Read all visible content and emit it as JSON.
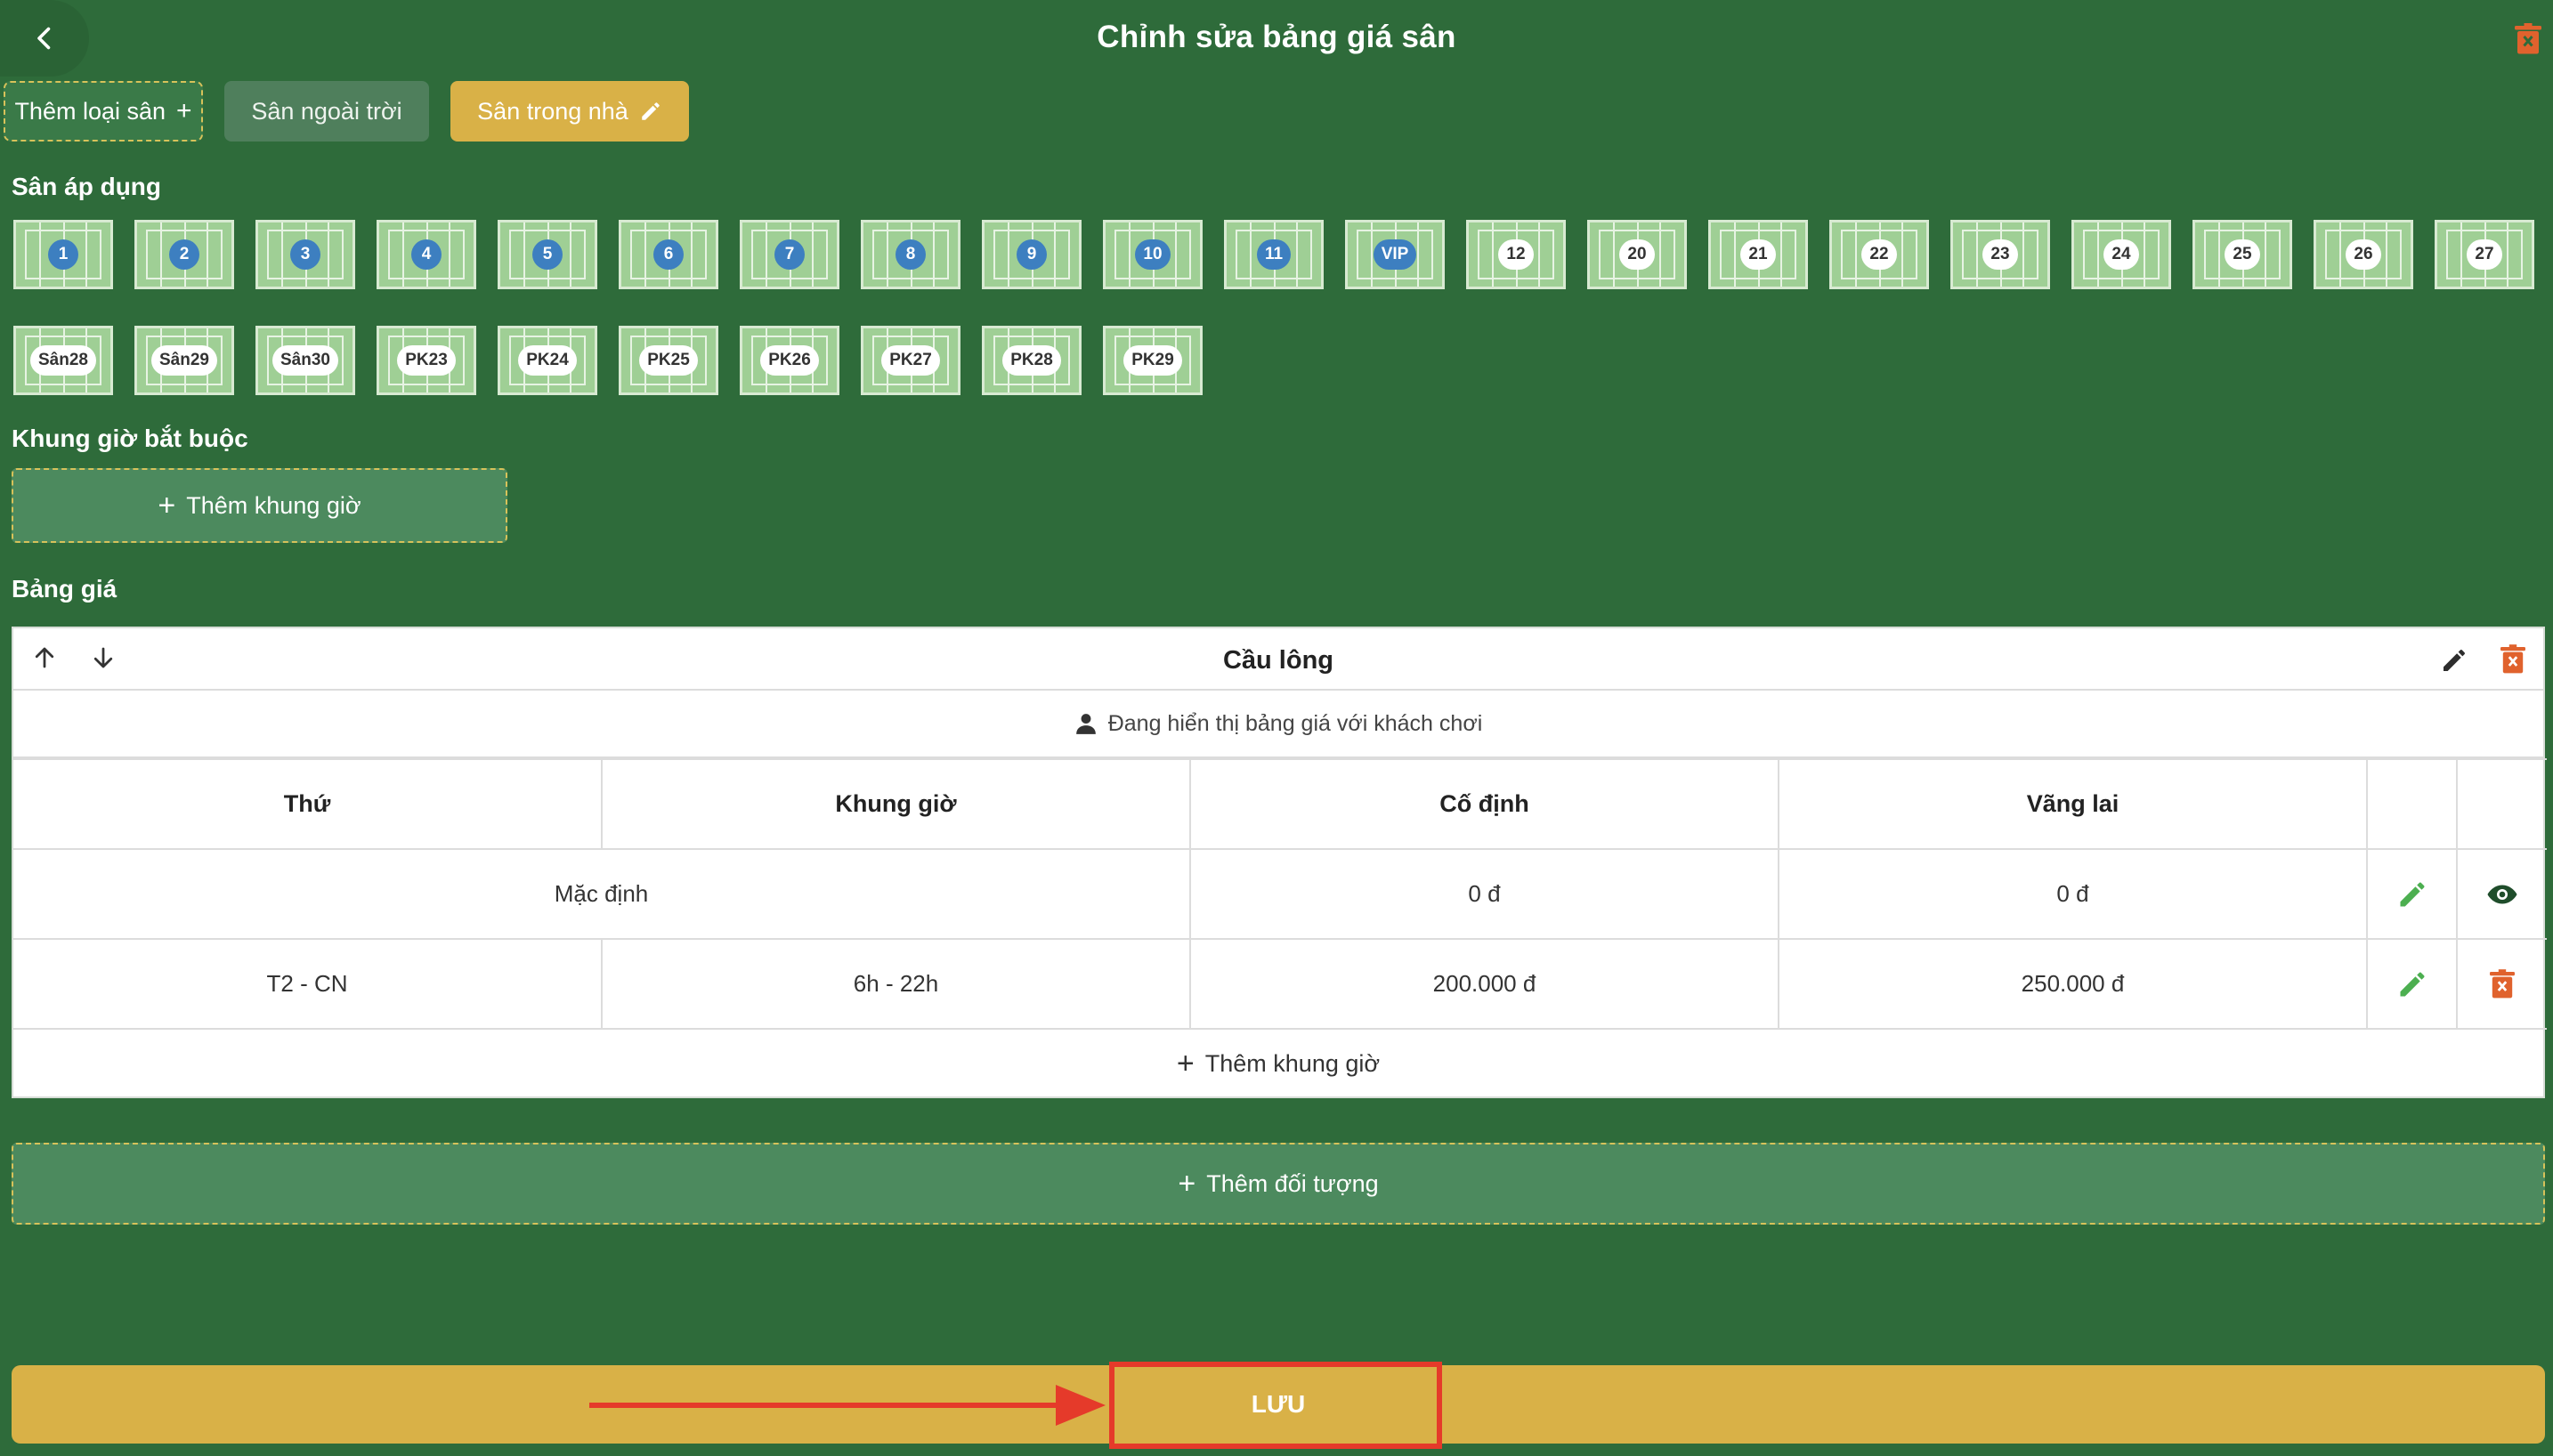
{
  "header": {
    "title": "Chỉnh sửa bảng giá sân"
  },
  "tabs": {
    "add_label": "Thêm loại sân",
    "items": [
      "Sân ngoài trời",
      "Sân trong nhà"
    ],
    "active": "Sân trong nhà"
  },
  "courts": {
    "label": "Sân áp dụng",
    "row1": [
      {
        "name": "1",
        "selected": true
      },
      {
        "name": "2",
        "selected": true
      },
      {
        "name": "3",
        "selected": true
      },
      {
        "name": "4",
        "selected": true
      },
      {
        "name": "5",
        "selected": true
      },
      {
        "name": "6",
        "selected": true
      },
      {
        "name": "7",
        "selected": true
      },
      {
        "name": "8",
        "selected": true
      },
      {
        "name": "9",
        "selected": true
      },
      {
        "name": "10",
        "selected": true
      },
      {
        "name": "11",
        "selected": true
      },
      {
        "name": "VIP",
        "selected": true
      },
      {
        "name": "12",
        "selected": false
      },
      {
        "name": "20",
        "selected": false
      },
      {
        "name": "21",
        "selected": false
      },
      {
        "name": "22",
        "selected": false
      },
      {
        "name": "23",
        "selected": false
      },
      {
        "name": "24",
        "selected": false
      },
      {
        "name": "25",
        "selected": false
      },
      {
        "name": "26",
        "selected": false
      },
      {
        "name": "27",
        "selected": false
      }
    ],
    "row2": [
      {
        "name": "Sân28",
        "selected": false
      },
      {
        "name": "Sân29",
        "selected": false
      },
      {
        "name": "Sân30",
        "selected": false
      },
      {
        "name": "PK23",
        "selected": false
      },
      {
        "name": "PK24",
        "selected": false
      },
      {
        "name": "PK25",
        "selected": false
      },
      {
        "name": "PK26",
        "selected": false
      },
      {
        "name": "PK27",
        "selected": false
      },
      {
        "name": "PK28",
        "selected": false
      },
      {
        "name": "PK29",
        "selected": false
      }
    ]
  },
  "required_time": {
    "label": "Khung giờ bắt buộc",
    "add_label": "Thêm khung giờ"
  },
  "price_table": {
    "label": "Bảng giá",
    "sport_name": "Cầu lông",
    "info": "Đang hiển thị bảng giá với khách chơi",
    "columns": [
      "Thứ",
      "Khung giờ",
      "Cố định",
      "Vãng lai"
    ],
    "default_row": {
      "label": "Mặc định",
      "fixed": "0 đ",
      "walkin": "0 đ"
    },
    "rows": [
      {
        "day": "T2 - CN",
        "time": "6h - 22h",
        "fixed": "200.000 đ",
        "walkin": "250.000 đ"
      }
    ],
    "add_time_label": "Thêm khung giờ"
  },
  "add_object_label": "Thêm đối tượng",
  "save_label": "LƯU",
  "colors": {
    "background": "#2e6b3a",
    "accent": "#d9b147",
    "selected_badge": "#3d7fc0",
    "danger": "#e0622d",
    "edit_green": "#4caf50",
    "annotation_red": "#e53a2a"
  }
}
